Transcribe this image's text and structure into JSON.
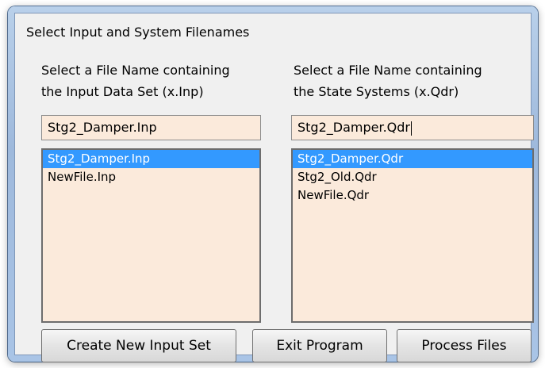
{
  "window": {
    "title": "Select Input and System Filenames"
  },
  "input_panel": {
    "caption_line1": "Select a File Name containing",
    "caption_line2": "the Input Data Set (x.Inp)",
    "field_value": "Stg2_Damper.Inp",
    "items": [
      {
        "label": "Stg2_Damper.Inp",
        "selected": true
      },
      {
        "label": "NewFile.Inp",
        "selected": false
      }
    ]
  },
  "system_panel": {
    "caption_line1": "Select a File Name containing",
    "caption_line2": "the State Systems (x.Qdr)",
    "field_value": "Stg2_Damper.Qdr",
    "items": [
      {
        "label": "Stg2_Damper.Qdr",
        "selected": true
      },
      {
        "label": "Stg2_Old.Qdr",
        "selected": false
      },
      {
        "label": "NewFile.Qdr",
        "selected": false
      }
    ]
  },
  "buttons": {
    "create_label": "Create New Input Set",
    "exit_label": "Exit Program",
    "process_label": "Process Files"
  },
  "colors": {
    "field_background": "#fbeadb",
    "selection": "#3399ff"
  }
}
